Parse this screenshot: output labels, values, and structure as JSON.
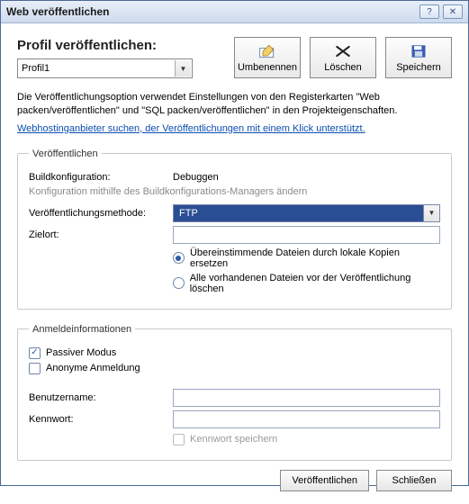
{
  "window": {
    "title": "Web veröffentlichen"
  },
  "titlebar_buttons": {
    "help": "?",
    "close": "✕"
  },
  "profile": {
    "heading": "Profil veröffentlichen:",
    "selected": "Profil1",
    "buttons": {
      "rename": "Umbenennen",
      "delete": "Löschen",
      "save": "Speichern"
    }
  },
  "description": "Die Veröffentlichungsoption verwendet Einstellungen von den Registerkarten \"Web packen/veröffentlichen\" und \"SQL packen/veröffentlichen\" in den Projekteigenschaften.",
  "link": "Webhostinganbieter suchen, der Veröffentlichungen mit einem Klick unterstützt.",
  "publish_group": {
    "legend": "Veröffentlichen",
    "build_config_label": "Buildkonfiguration:",
    "build_config_value": "Debuggen",
    "build_config_note": "Konfiguration mithilfe des Buildkonfigurations-Managers ändern",
    "method_label": "Veröffentlichungsmethode:",
    "method_value": "FTP",
    "target_label": "Zielort:",
    "target_value": "",
    "radio_replace": "Übereinstimmende Dateien durch lokale Kopien ersetzen",
    "radio_delete": "Alle vorhandenen Dateien vor der Veröffentlichung löschen",
    "radio_selected": "replace"
  },
  "creds_group": {
    "legend": "Anmeldeinformationen",
    "passive_label": "Passiver Modus",
    "passive_checked": true,
    "anon_label": "Anonyme Anmeldung",
    "anon_checked": false,
    "user_label": "Benutzername:",
    "user_value": "",
    "pass_label": "Kennwort:",
    "pass_value": "",
    "save_pass_label": "Kennwort speichern",
    "save_pass_checked": false,
    "save_pass_enabled": false
  },
  "buttons": {
    "publish": "Veröffentlichen",
    "close": "Schließen"
  }
}
